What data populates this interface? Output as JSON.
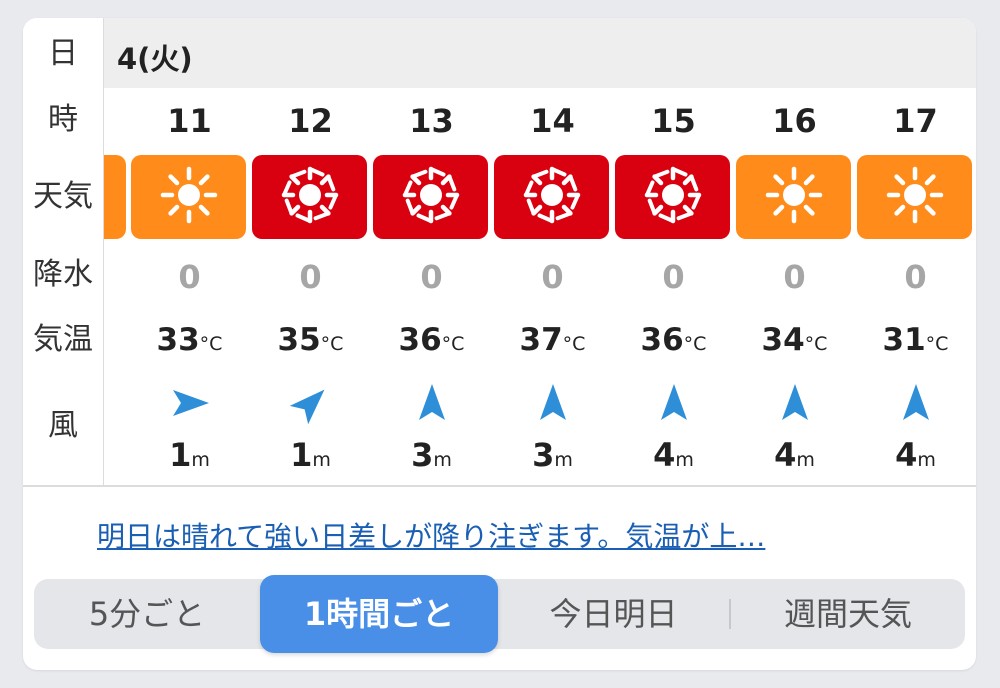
{
  "labels": {
    "day": "日",
    "hour": "時",
    "weather": "天気",
    "precip": "降水",
    "temp": "気温",
    "wind": "風"
  },
  "day_header": "4(火)",
  "colors": {
    "hot_orange": "#ff8c1a",
    "very_hot_red": "#d9000f",
    "wind_arrow": "#2e8fd8",
    "link": "#1a5fb4",
    "active_tab": "#4a8fe7"
  },
  "hours": [
    {
      "hour": "11",
      "weather_icon": "sun-icon",
      "weather_color": "#ff8c1a",
      "precip": "0",
      "temp": "33",
      "temp_unit": "°C",
      "wind_speed": "1",
      "wind_unit": "m",
      "wind_dir_deg": 90
    },
    {
      "hour": "12",
      "weather_icon": "sun-strong-icon",
      "weather_color": "#d9000f",
      "precip": "0",
      "temp": "35",
      "temp_unit": "°C",
      "wind_speed": "1",
      "wind_unit": "m",
      "wind_dir_deg": 45
    },
    {
      "hour": "13",
      "weather_icon": "sun-strong-icon",
      "weather_color": "#d9000f",
      "precip": "0",
      "temp": "36",
      "temp_unit": "°C",
      "wind_speed": "3",
      "wind_unit": "m",
      "wind_dir_deg": 0
    },
    {
      "hour": "14",
      "weather_icon": "sun-strong-icon",
      "weather_color": "#d9000f",
      "precip": "0",
      "temp": "37",
      "temp_unit": "°C",
      "wind_speed": "3",
      "wind_unit": "m",
      "wind_dir_deg": 0
    },
    {
      "hour": "15",
      "weather_icon": "sun-strong-icon",
      "weather_color": "#d9000f",
      "precip": "0",
      "temp": "36",
      "temp_unit": "°C",
      "wind_speed": "4",
      "wind_unit": "m",
      "wind_dir_deg": 0
    },
    {
      "hour": "16",
      "weather_icon": "sun-icon",
      "weather_color": "#ff8c1a",
      "precip": "0",
      "temp": "34",
      "temp_unit": "°C",
      "wind_speed": "4",
      "wind_unit": "m",
      "wind_dir_deg": 0
    },
    {
      "hour": "17",
      "weather_icon": "sun-icon",
      "weather_color": "#ff8c1a",
      "precip": "0",
      "temp": "31",
      "temp_unit": "°C",
      "wind_speed": "4",
      "wind_unit": "m",
      "wind_dir_deg": 0
    }
  ],
  "summary_link": "明日は晴れて強い日差しが降り注ぎます。気温が上…",
  "tabs": [
    {
      "label": "5分ごと",
      "active": false
    },
    {
      "label": "1時間ごと",
      "active": true
    },
    {
      "label": "今日明日",
      "active": false
    },
    {
      "label": "週間天気",
      "active": false
    }
  ]
}
